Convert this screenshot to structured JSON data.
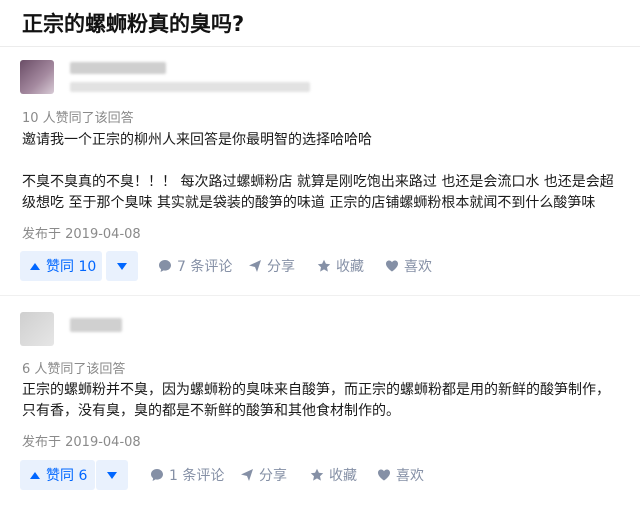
{
  "question": {
    "title": "正宗的螺蛳粉真的臭吗?"
  },
  "answers": [
    {
      "upvote_text": "10 人赞同了该回答",
      "paragraphs": [
        "邀请我一个正宗的柳州人来回答是你最明智的选择哈哈哈",
        "不臭不臭真的不臭！！！ 每次路过螺蛳粉店 就算是刚吃饱出来路过 也还是会流口水 也还是会超级想吃 至于那个臭味 其实就是袋装的酸笋的味道 正宗的店铺螺蛳粉根本就闻不到什么酸笋味"
      ],
      "date": "发布于 2019-04-08",
      "vote_label": "赞同 10",
      "comments": "7 条评论",
      "share": "分享",
      "favorite": "收藏",
      "like": "喜欢"
    },
    {
      "upvote_text": "6 人赞同了该回答",
      "paragraphs": [
        "正宗的螺蛳粉并不臭，因为螺蛳粉的臭味来自酸笋，而正宗的螺蛳粉都是用的新鲜的酸笋制作，只有香，没有臭，臭的都是不新鲜的酸笋和其他食材制作的。"
      ],
      "date": "发布于 2019-04-08",
      "vote_label": "赞同 6",
      "comments": "1 条评论",
      "share": "分享",
      "favorite": "收藏",
      "like": "喜欢"
    }
  ],
  "colors": {
    "accent": "#0066ff",
    "vote_bg": "#e9f1fd",
    "meta": "#8590a6"
  }
}
